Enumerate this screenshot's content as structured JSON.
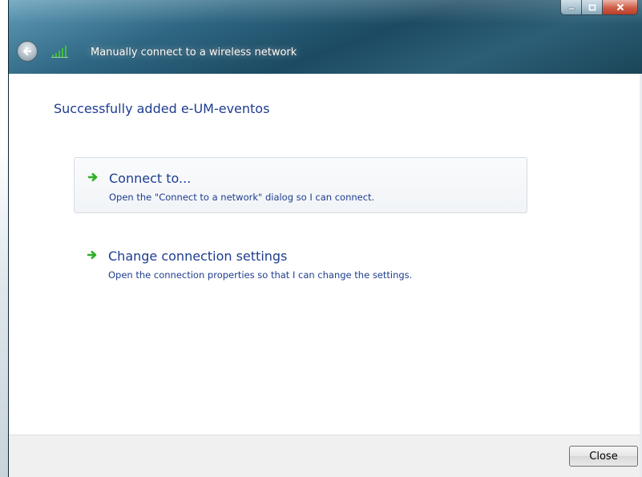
{
  "window": {
    "title": "Manually connect to a wireless network",
    "controls": {
      "minimize": "minimize",
      "maximize": "maximize",
      "close": "close"
    }
  },
  "heading": "Successfully added e-UM-eventos",
  "tasks": [
    {
      "title": "Connect to...",
      "description": "Open the \"Connect to a network\" dialog so I can connect."
    },
    {
      "title": "Change connection settings",
      "description": "Open the connection properties so that I can change the settings."
    }
  ],
  "footer": {
    "close_label": "Close"
  },
  "icons": {
    "back": "back-arrow-icon",
    "network": "wireless-signal-icon",
    "task": "green-arrow-icon"
  },
  "colors": {
    "link_blue": "#1e3d8f",
    "arrow_green": "#2fae2a",
    "footer_bg": "#f0f0f0"
  }
}
